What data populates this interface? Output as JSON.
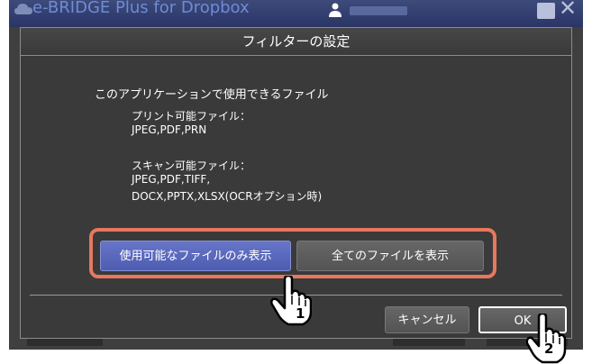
{
  "app": {
    "title": "e-BRIDGE Plus for Dropbox"
  },
  "dialog": {
    "title": "フィルターの設定",
    "description_title": "このアプリケーションで使用できるファイル",
    "print_label": "プリント可能ファイル：",
    "print_types": "JPEG,PDF,PRN",
    "scan_label": "スキャン可能ファイル：",
    "scan_types_1": "JPEG,PDF,TIFF,",
    "scan_types_2": "DOCX,PPTX,XLSX(OCRオプション時)",
    "filter_available_label": "使用可能なファイルのみ表示",
    "filter_all_label": "全てのファイルを表示",
    "cancel_label": "キャンセル",
    "ok_label": "OK"
  },
  "callouts": {
    "step1": "1",
    "step2": "2"
  },
  "colors": {
    "highlight": "#e8785d",
    "selected_button": "#5563b8",
    "dialog_bg": "#3a3a3a"
  }
}
